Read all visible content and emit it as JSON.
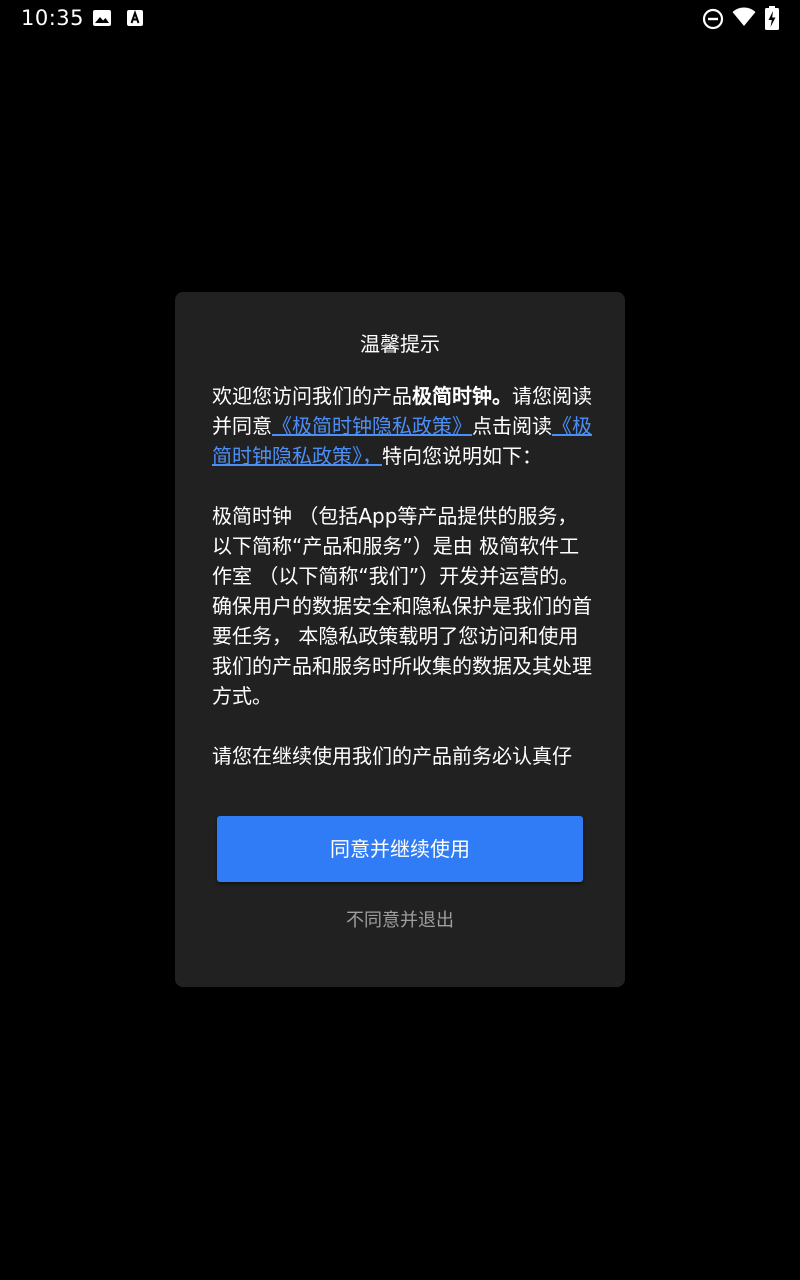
{
  "status_bar": {
    "time": "10:35",
    "left_icons": [
      "image-notification-icon",
      "text-notification-icon"
    ],
    "right_icons": [
      "do-not-disturb-icon",
      "wifi-icon",
      "battery-charging-icon"
    ]
  },
  "dialog": {
    "title": "温馨提示",
    "body": {
      "p1_prefix": "欢迎您访问我们的产品",
      "p1_product": "极简时钟。",
      "p1_after_product": "请您阅读并同意",
      "p1_link1": "《极简时钟隐私政策》",
      "p1_middle": "点击阅读",
      "p1_link2": "《极简时钟隐私政策》，",
      "p1_suffix": "特向您说明如下：",
      "p2": "极简时钟 （包括App等产品提供的服务，以下简称“产品和服务”）是由 极简软件工作室 （以下简称“我们”）开发并运营的。 确保用户的数据安全和隐私保护是我们的首要任务， 本隐私政策载明了您访问和使用我们的产品和服务时所收集的数据及其处理方式。",
      "p3": "请您在继续使用我们的产品前务必认真仔"
    },
    "agree_button": "同意并继续使用",
    "disagree_link": "不同意并退出"
  },
  "colors": {
    "background": "#000000",
    "dialog_background": "#212121",
    "accent": "#2f7cf6",
    "link": "#4c8ef7",
    "secondary_text": "#9e9e9e"
  }
}
